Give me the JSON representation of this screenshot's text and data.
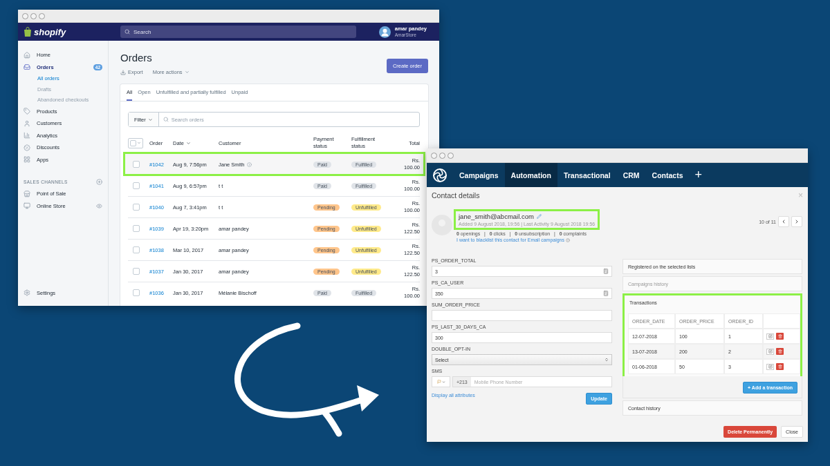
{
  "shopify_window": {
    "logo": "shopify",
    "search_placeholder": "Search",
    "user": {
      "name": "amar pandey",
      "store": "AmarStore"
    },
    "sidebar": {
      "items": [
        {
          "label": "Home",
          "selected": false
        },
        {
          "label": "Orders",
          "selected": true,
          "badge": "42",
          "children": [
            {
              "label": "All orders",
              "selected": true
            },
            {
              "label": "Drafts",
              "selected": false
            },
            {
              "label": "Abandoned checkouts",
              "selected": false
            }
          ]
        },
        {
          "label": "Products",
          "selected": false
        },
        {
          "label": "Customers",
          "selected": false
        },
        {
          "label": "Analytics",
          "selected": false
        },
        {
          "label": "Discounts",
          "selected": false
        },
        {
          "label": "Apps",
          "selected": false
        }
      ],
      "section_title": "SALES CHANNELS",
      "channels": [
        {
          "label": "Point of Sale",
          "eye": false
        },
        {
          "label": "Online Store",
          "eye": true
        }
      ],
      "settings": "Settings"
    },
    "page_title": "Orders",
    "actions": [
      "Export",
      "More actions"
    ],
    "primary_button": "Create order",
    "tabs": [
      {
        "label": "All",
        "selected": true
      },
      {
        "label": "Open",
        "selected": false
      },
      {
        "label": "Unfulfilled and partially fulfilled",
        "selected": false
      },
      {
        "label": "Unpaid",
        "selected": false
      }
    ],
    "select_all": {
      "checked": false
    },
    "filter": "Filter",
    "search_orders_placeholder": "Search orders",
    "columns": [
      "Order",
      "Date",
      "Customer",
      "Payment status",
      "Fulfillment status",
      "Total"
    ],
    "rows": [
      {
        "order": "#1042",
        "date": "Aug 9, 7:56pm",
        "customer": "Jane Smith",
        "info": true,
        "checked": false,
        "highlighted": true,
        "payment": {
          "text": "Paid",
          "color": "#dfe3e8"
        },
        "fulfillment": {
          "text": "Fulfilled",
          "color": "#dfe3e8"
        },
        "total": "Rs. 100.00"
      },
      {
        "order": "#1041",
        "date": "Aug 9, 6:57pm",
        "customer": "t t",
        "info": false,
        "checked": false,
        "highlighted": false,
        "payment": {
          "text": "Paid",
          "color": "#dfe3e8"
        },
        "fulfillment": {
          "text": "Fulfilled",
          "color": "#dfe3e8"
        },
        "total": "Rs. 100.00"
      },
      {
        "order": "#1040",
        "date": "Aug 7, 3:41pm",
        "customer": "t t",
        "info": false,
        "checked": false,
        "highlighted": false,
        "payment": {
          "text": "Pending",
          "color": "#ffc58b"
        },
        "fulfillment": {
          "text": "Unfulfilled",
          "color": "#ffea8a"
        },
        "total": "Rs. 100.00"
      },
      {
        "order": "#1039",
        "date": "Apr 19, 3:20pm",
        "customer": "amar pandey",
        "info": false,
        "checked": false,
        "highlighted": false,
        "payment": {
          "text": "Pending",
          "color": "#ffc58b"
        },
        "fulfillment": {
          "text": "Unfulfilled",
          "color": "#ffea8a"
        },
        "total": "Rs. 122.50"
      },
      {
        "order": "#1038",
        "date": "Mar 10, 2017",
        "customer": "amar pandey",
        "info": false,
        "checked": false,
        "highlighted": false,
        "payment": {
          "text": "Pending",
          "color": "#ffc58b"
        },
        "fulfillment": {
          "text": "Unfulfilled",
          "color": "#ffea8a"
        },
        "total": "Rs. 122.50"
      },
      {
        "order": "#1037",
        "date": "Jan 30, 2017",
        "customer": "amar pandey",
        "info": false,
        "checked": false,
        "highlighted": false,
        "payment": {
          "text": "Pending",
          "color": "#ffc58b"
        },
        "fulfillment": {
          "text": "Unfulfilled",
          "color": "#ffea8a"
        },
        "total": "Rs. 122.50"
      },
      {
        "order": "#1036",
        "date": "Jan 30, 2017",
        "customer": "Mélanie Bischoff",
        "info": false,
        "checked": false,
        "highlighted": false,
        "payment": {
          "text": "Paid",
          "color": "#dfe3e8"
        },
        "fulfillment": {
          "text": "Fulfilled",
          "color": "#dfe3e8"
        },
        "total": "Rs. 100.00"
      }
    ]
  },
  "crm_window": {
    "nav": [
      {
        "label": "Campaigns",
        "selected": false
      },
      {
        "label": "Automation",
        "selected": true
      },
      {
        "label": "Transactional",
        "selected": false
      },
      {
        "label": "CRM",
        "selected": false
      },
      {
        "label": "Contacts",
        "selected": false
      }
    ],
    "nav_add": "+",
    "title": "Contact details",
    "close": "×",
    "contact": {
      "email": "jane_smith@abcmail.com",
      "highlighted": true,
      "meta": "Added 9 August 2018, 19:56 | Last Activity 9 August 2018 19:56",
      "stats": "**0** openings   |   **0** clicks   |   **0** unsubscription   |   **0** complaints",
      "blacklist_link": "I want to blacklist this contact for Email campaigns"
    },
    "fields": [
      {
        "label": "PS_ORDER_TOTAL",
        "kind": "counter",
        "value": "3"
      },
      {
        "label": "PS_CA_USER",
        "kind": "counter",
        "value": "350"
      },
      {
        "label": "SUM_ORDER_PRICE",
        "kind": "text"
      },
      {
        "label": "PS_LAST_30_DAYS_CA",
        "kind": "text",
        "value": "300"
      },
      {
        "label": "DOUBLE_OPT-IN",
        "kind": "select",
        "value": "Select"
      },
      {
        "label": "SMS",
        "kind": "phone",
        "prefix": "+213",
        "placeholder": "Mobile Phone Number"
      }
    ],
    "display_all": "Display all attributes",
    "update": "Update",
    "pager": "10 of 11",
    "panels": [
      {
        "kind": "header",
        "title": "Registered on the selected lists",
        "disabled": false,
        "highlighted": false
      },
      {
        "kind": "header",
        "title": "Campaigns history",
        "disabled": true,
        "highlighted": false
      },
      {
        "kind": "table",
        "title": "Transactions",
        "disabled": false,
        "highlighted": true,
        "columns": [
          "ORDER_DATE",
          "ORDER_PRICE",
          "ORDER_ID"
        ],
        "rows": [
          [
            "12-07-2018",
            "100",
            "1"
          ],
          [
            "13-07-2018",
            "200",
            "2"
          ],
          [
            "01-06-2018",
            "50",
            "3"
          ]
        ],
        "add_button": "+ Add a transaction"
      },
      {
        "kind": "header",
        "title": "Contact history",
        "disabled": false,
        "highlighted": false
      }
    ],
    "delete_button": "Delete Permanently",
    "close_button": "Close"
  }
}
